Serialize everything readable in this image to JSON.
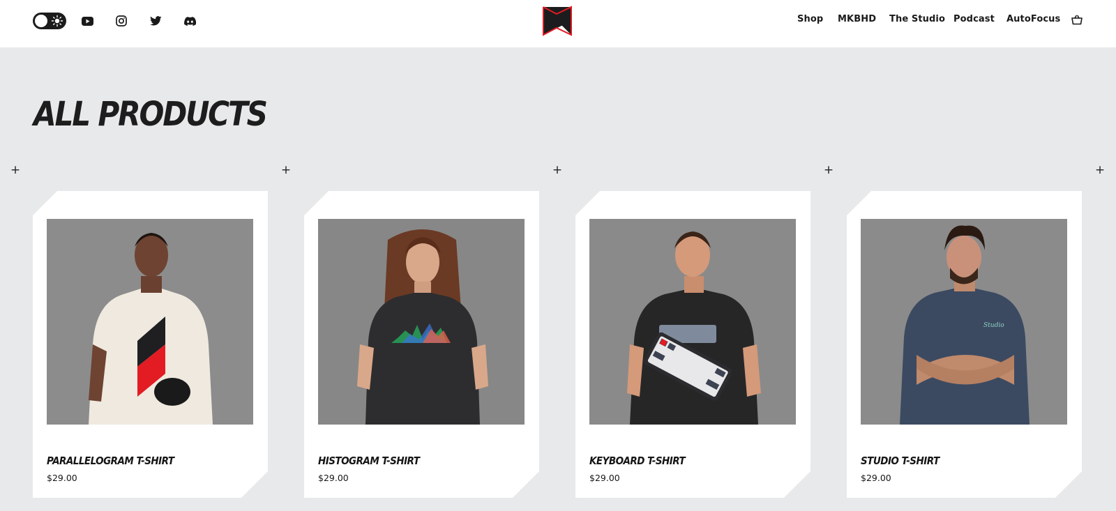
{
  "header": {
    "nav": [
      {
        "label": "Shop"
      },
      {
        "label": "MKBHD"
      },
      {
        "label": "The Studio"
      },
      {
        "label": "Podcast"
      },
      {
        "label": "AutoFocus"
      }
    ],
    "icons": [
      "theme-toggle",
      "youtube-icon",
      "instagram-icon",
      "twitter-icon",
      "discord-icon",
      "cart-icon"
    ]
  },
  "page": {
    "title": "ALL PRODUCTS"
  },
  "products": [
    {
      "name": "PARALLELOGRAM T-SHIRT",
      "price": "$29.00",
      "shirt_color": "#efe9df"
    },
    {
      "name": "HISTOGRAM T-SHIRT",
      "price": "$29.00",
      "shirt_color": "#2d2d2f"
    },
    {
      "name": "KEYBOARD T-SHIRT",
      "price": "$29.00",
      "shirt_color": "#262627"
    },
    {
      "name": "STUDIO T-SHIRT",
      "price": "$29.00",
      "shirt_color": "#3b4a61"
    }
  ],
  "colors": {
    "background": "#e8e9ea",
    "brand_red": "#e31b23",
    "photo_backdrop": "#8a8a8a"
  }
}
